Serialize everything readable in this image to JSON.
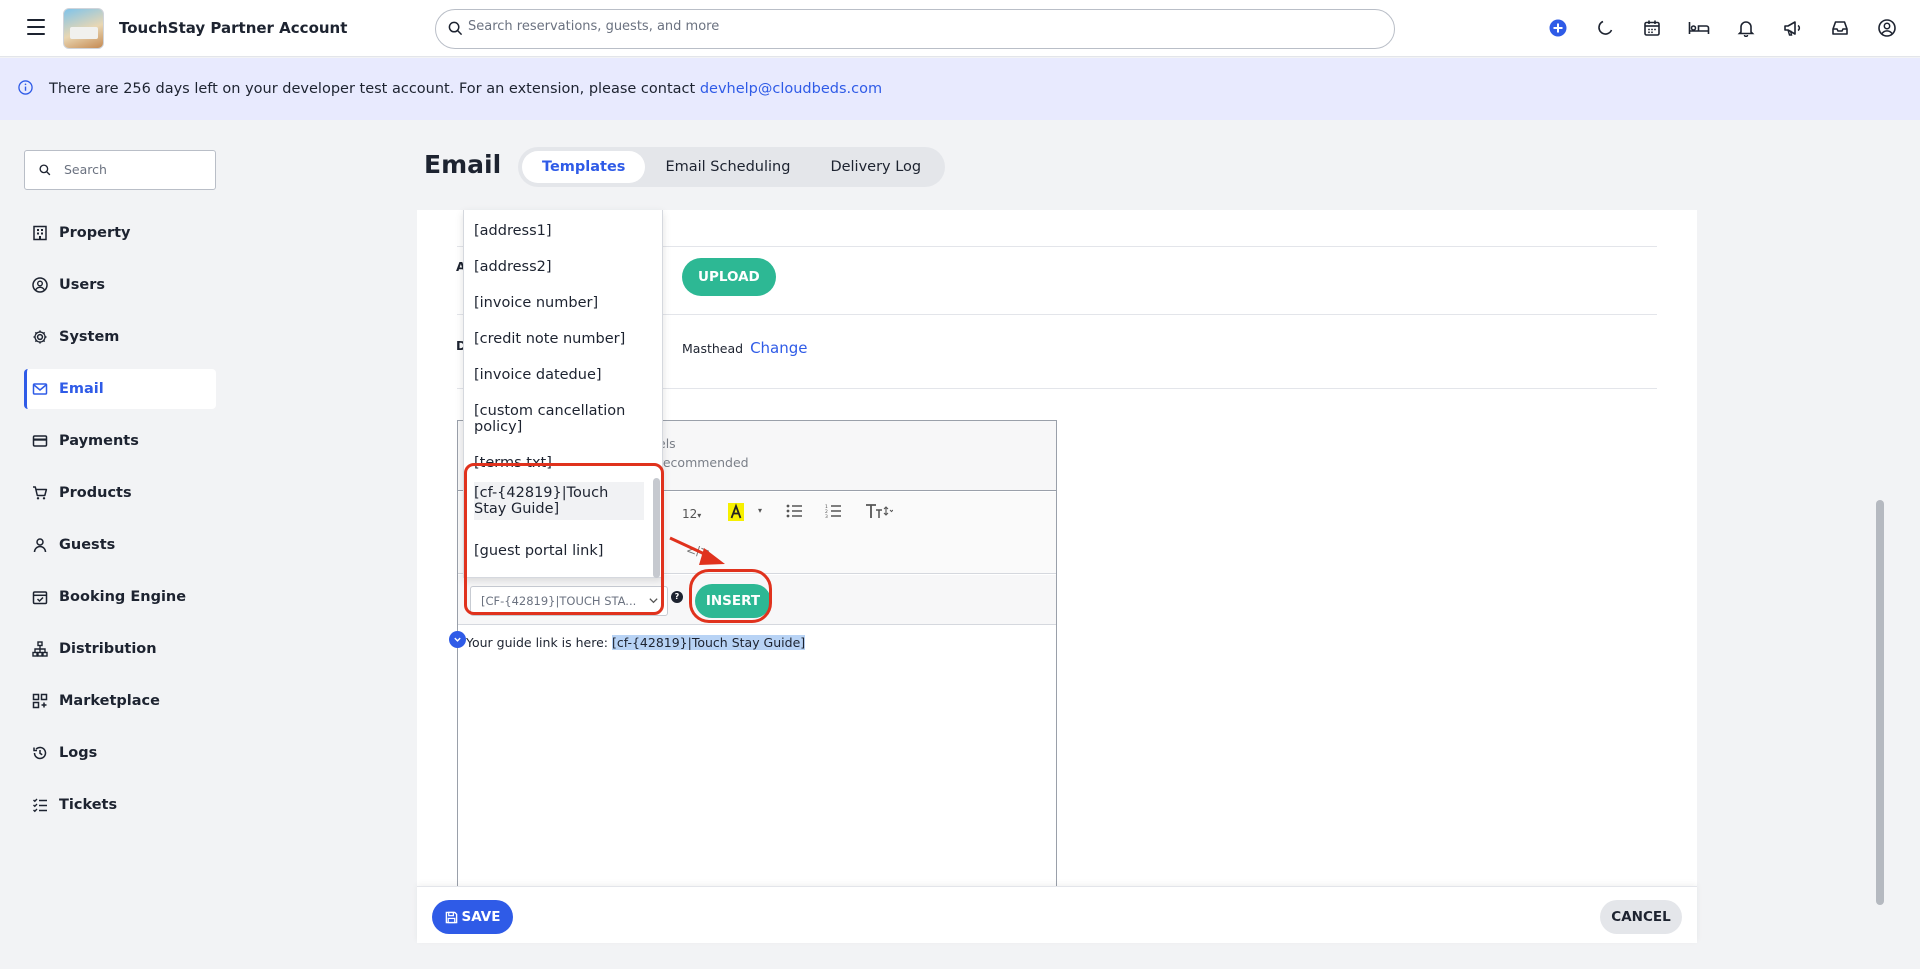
{
  "header": {
    "title": "TouchStay Partner Account",
    "search_placeholder": "Search reservations, guests, and more"
  },
  "banner": {
    "text": "There are 256 days left on your developer test account. For an extension, please contact ",
    "link": "devhelp@cloudbeds.com"
  },
  "sidebar": {
    "search_placeholder": "Search",
    "items": [
      {
        "label": "Property",
        "icon": "building-icon"
      },
      {
        "label": "Users",
        "icon": "user-circle-icon"
      },
      {
        "label": "System",
        "icon": "gear-icon"
      },
      {
        "label": "Email",
        "icon": "mail-icon",
        "active": true
      },
      {
        "label": "Payments",
        "icon": "credit-card-icon"
      },
      {
        "label": "Products",
        "icon": "cart-icon"
      },
      {
        "label": "Guests",
        "icon": "person-icon"
      },
      {
        "label": "Booking Engine",
        "icon": "calendar-check-icon"
      },
      {
        "label": "Distribution",
        "icon": "network-icon"
      },
      {
        "label": "Marketplace",
        "icon": "grid-plus-icon"
      },
      {
        "label": "Logs",
        "icon": "history-icon"
      },
      {
        "label": "Tickets",
        "icon": "checklist-icon"
      }
    ]
  },
  "page": {
    "title": "Email",
    "tabs": [
      "Templates",
      "Email Scheduling",
      "Delivery Log"
    ],
    "active_tab": "Templates"
  },
  "form": {
    "upload_label": "UPLOAD",
    "masthead_label": "Masthead",
    "masthead_link": "Change",
    "row_label_a": "A",
    "row_label_d": "D",
    "editor_hint_1": "els",
    "editor_hint_2": "recommended",
    "font_size": "12",
    "code_glyph": "</>"
  },
  "placeholder_dropdown": {
    "items": [
      "[address1]",
      "[address2]",
      "[invoice number]",
      "[credit note number]",
      "[invoice datedue]",
      "[custom cancellation policy]",
      "[terms txt]",
      "[cf-{42819}|Touch Stay Guide]",
      "[guest portal link]"
    ],
    "selected_display": "[CF-{42819}|TOUCH STA...",
    "insert_label": "INSERT",
    "help_glyph": "?"
  },
  "editor_content": {
    "prefix": "Your guide link is here: ",
    "highlighted": "[cf-{42819}|Touch Stay Guide]"
  },
  "footer": {
    "save_label": "SAVE",
    "cancel_label": "CANCEL"
  },
  "colors": {
    "accent": "#2f5be7",
    "green": "#2db894",
    "annotation_red": "#e0321d",
    "banner_bg": "#e8eafe"
  }
}
